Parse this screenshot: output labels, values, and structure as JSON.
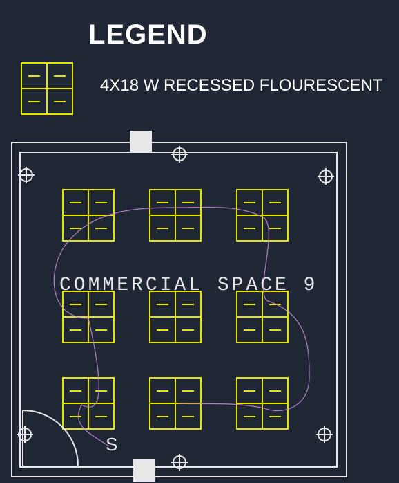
{
  "legend": {
    "title": "LEGEND",
    "item1_label": "4X18 W RECESSED FLOURESCENT"
  },
  "room": {
    "label": "COMMERCIAL SPACE 9",
    "switch_label": "S"
  },
  "fixture_grid": {
    "rows": 3,
    "cols": 3,
    "type": "4x18W recessed fluorescent",
    "count": 9
  }
}
